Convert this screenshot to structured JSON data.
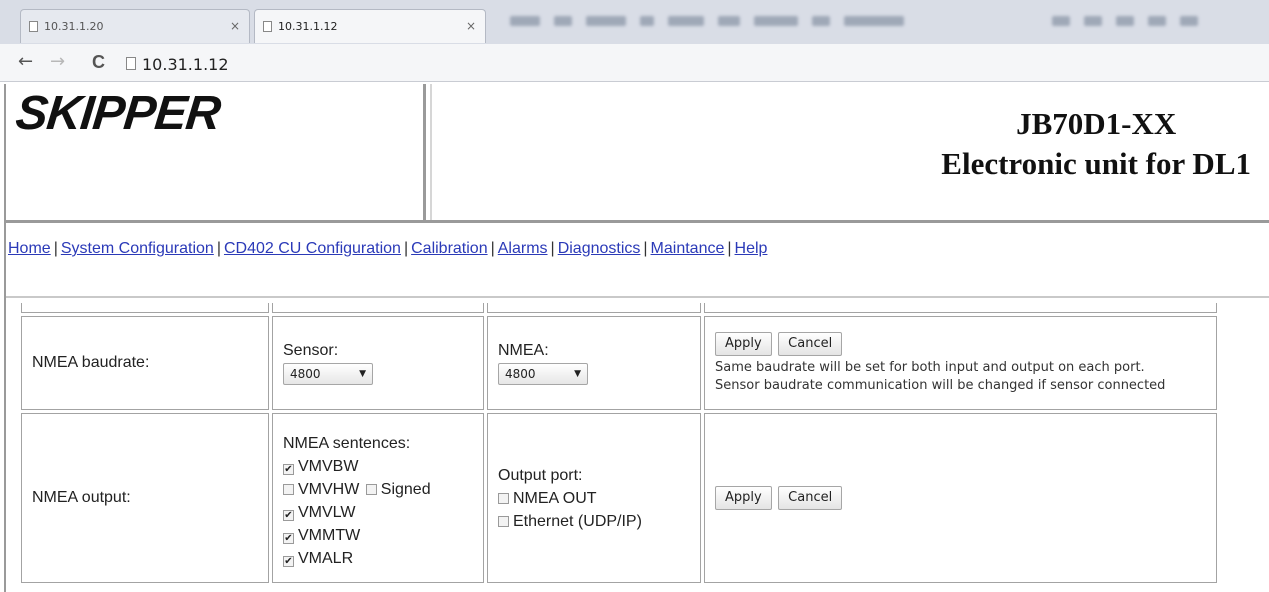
{
  "browser": {
    "tabs": [
      {
        "title": "10.31.1.20",
        "close": "×"
      },
      {
        "title": "10.31.1.12",
        "close": "×"
      }
    ],
    "nav": {
      "back": "←",
      "forward": "→",
      "reload": "C"
    },
    "url": "10.31.1.12"
  },
  "header": {
    "logo": "SKIPPER",
    "model": "JB70D1-XX",
    "subtitle": "Electronic unit for DL1"
  },
  "menu": {
    "items": [
      "Home",
      "System Configuration",
      "CD402 CU Configuration",
      "Calibration",
      "Alarms",
      "Diagnostics",
      "Maintance",
      "Help"
    ],
    "separator": "|"
  },
  "baudrate": {
    "label": "NMEA baudrate:",
    "sensor_label": "Sensor:",
    "sensor_value": "4800",
    "nmea_label": "NMEA:",
    "nmea_value": "4800",
    "apply": "Apply",
    "cancel": "Cancel",
    "note1": "Same baudrate will be set for both input and output on each port.",
    "note2": "Sensor baudrate communication will be changed if sensor connected"
  },
  "output": {
    "label": "NMEA output:",
    "sentences_label": "NMEA sentences:",
    "sentences": [
      {
        "name": "VMVBW",
        "checked": true
      },
      {
        "name": "VMVHW",
        "checked": false
      },
      {
        "name": "VMVLW",
        "checked": true
      },
      {
        "name": "VMMTW",
        "checked": true
      },
      {
        "name": "VMALR",
        "checked": true
      }
    ],
    "signed_label": "Signed",
    "signed_checked": false,
    "port_label": "Output port:",
    "ports": [
      {
        "name": "NMEA OUT",
        "checked": false
      },
      {
        "name": "Ethernet (UDP/IP)",
        "checked": false
      }
    ],
    "apply": "Apply",
    "cancel": "Cancel"
  },
  "icons": {
    "checkmark": "✔",
    "dropdown_arrow": "▼"
  }
}
